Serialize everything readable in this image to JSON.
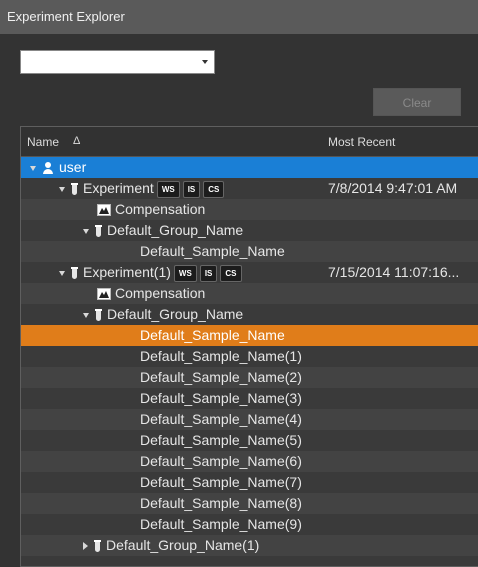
{
  "window": {
    "title": "Experiment Explorer"
  },
  "filter": {
    "value": ""
  },
  "clear_button": {
    "label": "Clear"
  },
  "columns": {
    "name": "Name",
    "sort": "Δ",
    "recent": "Most Recent"
  },
  "tree": {
    "user": "user",
    "exp1": {
      "name": "Experiment",
      "badges": [
        "WS",
        "IS",
        "CS"
      ],
      "recent": "7/8/2014 9:47:01 AM"
    },
    "exp1_comp": "Compensation",
    "exp1_group": "Default_Group_Name",
    "exp1_sample": "Default_Sample_Name",
    "exp2": {
      "name": "Experiment(1)",
      "badges": [
        "WS",
        "IS",
        "CS"
      ],
      "recent": "7/15/2014 11:07:16..."
    },
    "exp2_comp": "Compensation",
    "exp2_group": "Default_Group_Name",
    "samples": [
      "Default_Sample_Name",
      "Default_Sample_Name(1)",
      "Default_Sample_Name(2)",
      "Default_Sample_Name(3)",
      "Default_Sample_Name(4)",
      "Default_Sample_Name(5)",
      "Default_Sample_Name(6)",
      "Default_Sample_Name(7)",
      "Default_Sample_Name(8)",
      "Default_Sample_Name(9)"
    ],
    "group2": "Default_Group_Name(1)"
  },
  "colors": {
    "user_highlight": "#1a7fd6",
    "sample_highlight": "#e07d1a"
  }
}
